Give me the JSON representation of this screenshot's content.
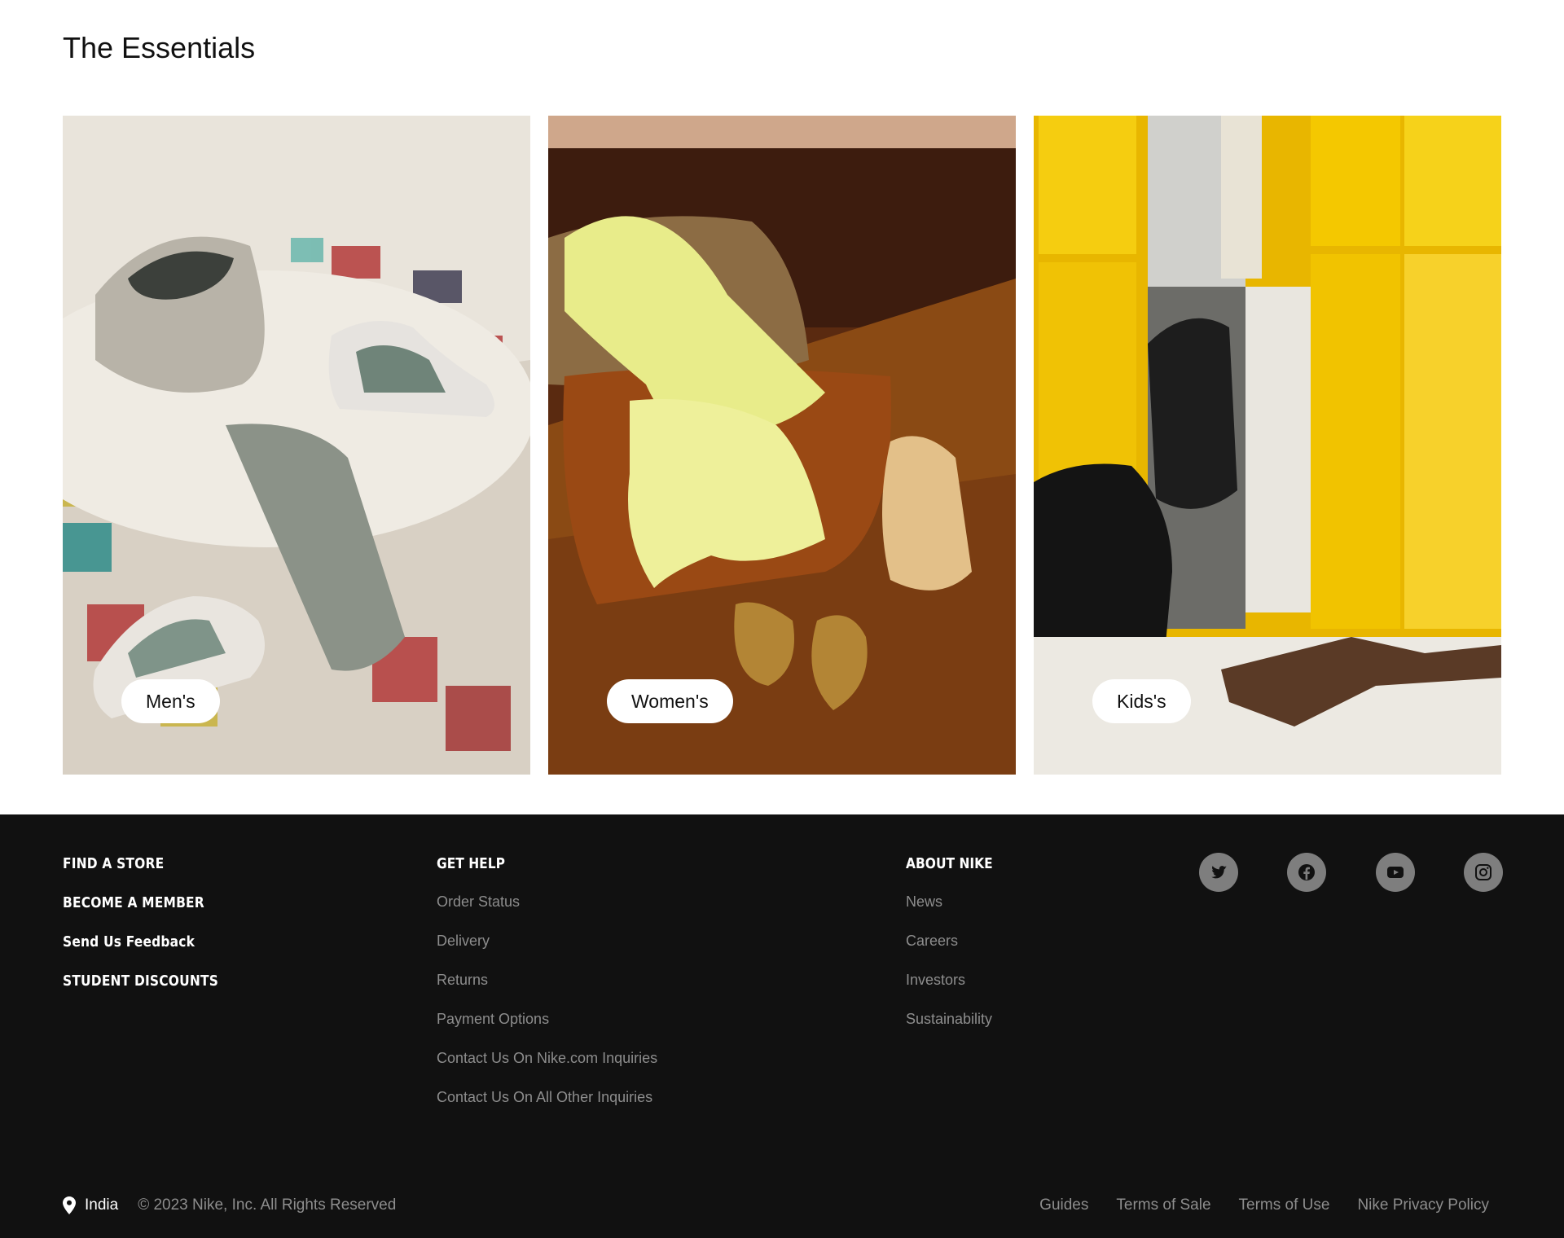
{
  "section": {
    "title": "The Essentials"
  },
  "cards": [
    {
      "label": "Men's"
    },
    {
      "label": "Women's"
    },
    {
      "label": "Kids's"
    }
  ],
  "footer": {
    "primary_links": [
      "FIND A STORE",
      "BECOME A MEMBER",
      "Send Us Feedback",
      "STUDENT DISCOUNTS"
    ],
    "get_help": {
      "heading": "GET HELP",
      "links": [
        "Order Status",
        "Delivery",
        "Returns",
        "Payment Options",
        "Contact Us On Nike.com Inquiries",
        "Contact Us On All Other Inquiries"
      ]
    },
    "about": {
      "heading": "ABOUT NIKE",
      "links": [
        "News",
        "Careers",
        "Investors",
        "Sustainability"
      ]
    },
    "social_icons": [
      "twitter-icon",
      "facebook-icon",
      "youtube-icon",
      "instagram-icon"
    ],
    "country": "India",
    "copyright": "© 2023 Nike, Inc. All Rights Reserved",
    "legal_links": [
      "Guides",
      "Terms of Sale",
      "Terms of Use",
      "Nike Privacy Policy"
    ]
  },
  "colors": {
    "footer_bg": "#111111",
    "footer_muted": "#8d8d8d",
    "social_bg": "#7e7e7e",
    "kids_yellow": "#f2c400",
    "women_brown": "#7a3d12"
  }
}
